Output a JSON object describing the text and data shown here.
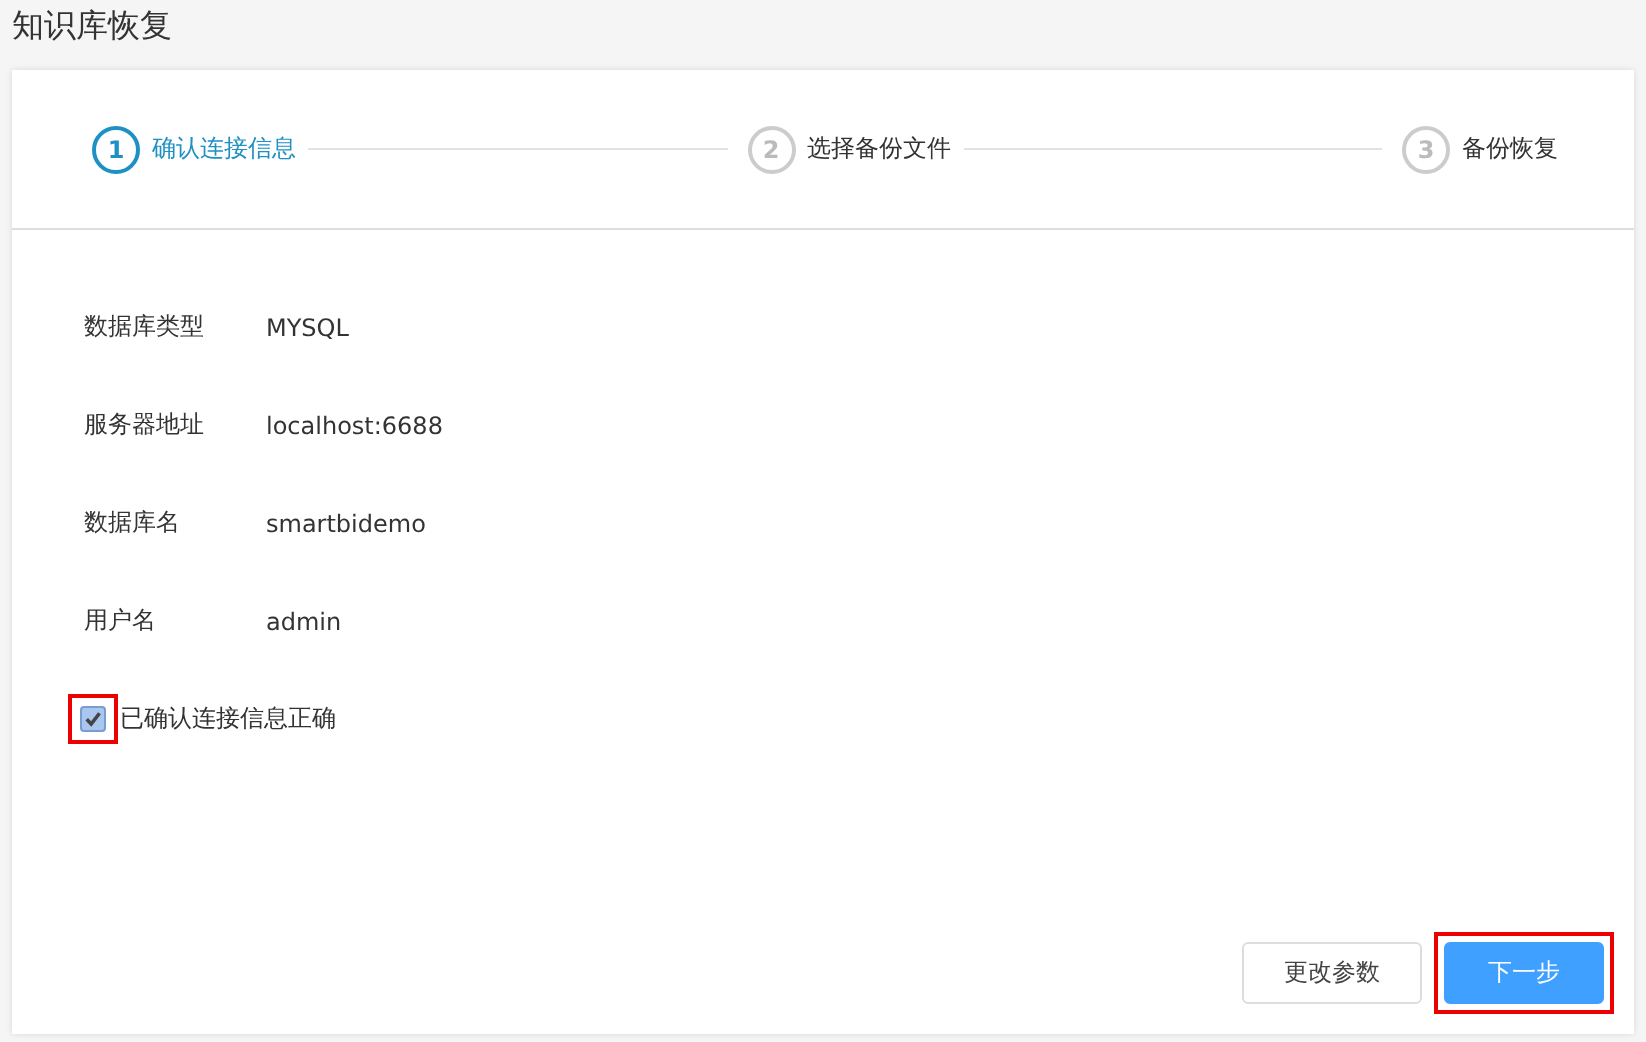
{
  "page_title": "知识库恢复",
  "steps": [
    {
      "number": "1",
      "label": "确认连接信息",
      "selected": true
    },
    {
      "number": "2",
      "label": "选择备份文件",
      "selected": false
    },
    {
      "number": "3",
      "label": "备份恢复",
      "selected": false
    }
  ],
  "fields": [
    {
      "label": "数据库类型",
      "value": "MYSQL"
    },
    {
      "label": "服务器地址",
      "value": "localhost:6688"
    },
    {
      "label": "数据库名",
      "value": "smartbidemo"
    },
    {
      "label": "用户名",
      "value": "admin"
    }
  ],
  "confirm": {
    "label": "已确认连接信息正确",
    "checked": true,
    "highlighted": true
  },
  "buttons": [
    {
      "label": "更改参数",
      "kind": "secondary",
      "highlighted": false
    },
    {
      "label": "下一步",
      "kind": "primary",
      "highlighted": true
    }
  ]
}
